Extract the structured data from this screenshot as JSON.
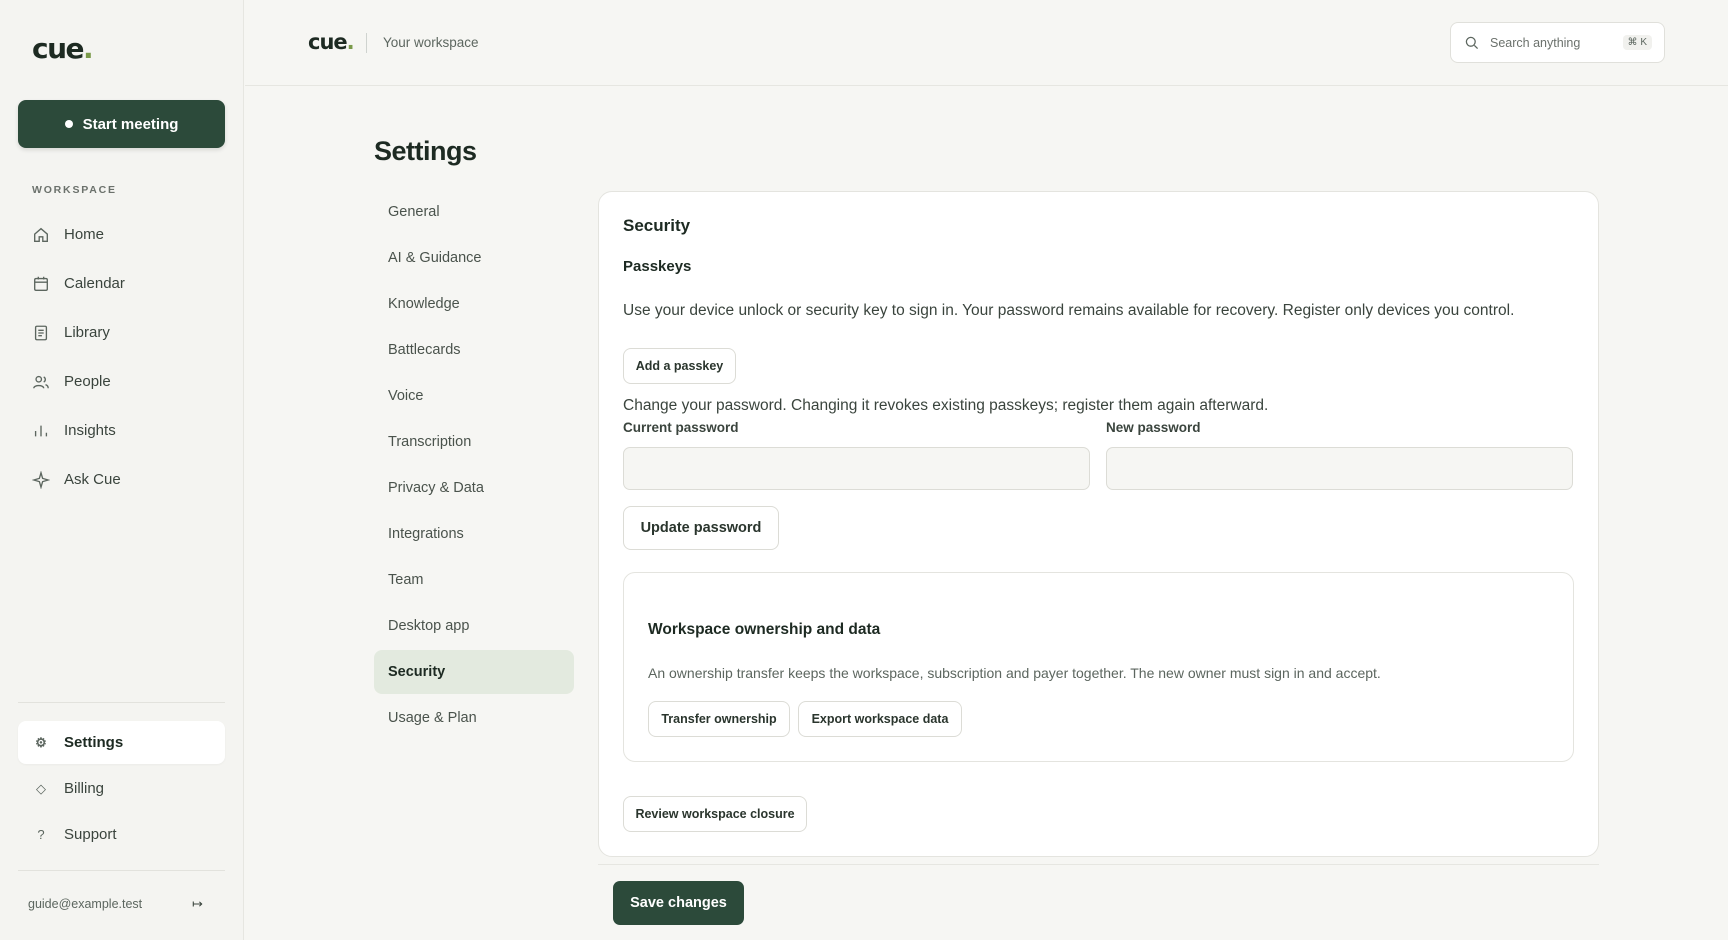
{
  "brand": {
    "logo_text": "cue",
    "logo_dot": "."
  },
  "sidebar": {
    "start_meeting": "Start meeting",
    "section_label": "WORKSPACE",
    "items": [
      {
        "label": "Home",
        "icon": "home-icon"
      },
      {
        "label": "Calendar",
        "icon": "calendar-icon"
      },
      {
        "label": "Library",
        "icon": "library-icon"
      },
      {
        "label": "People",
        "icon": "people-icon"
      },
      {
        "label": "Insights",
        "icon": "insights-icon"
      },
      {
        "label": "Ask Cue",
        "icon": "sparkle-icon"
      }
    ],
    "bottom_items": [
      {
        "label": "Settings",
        "icon": "gear-icon",
        "active": true
      },
      {
        "label": "Billing",
        "icon": "diamond-icon"
      },
      {
        "label": "Support",
        "icon": "help-icon"
      }
    ],
    "user_email": "guide@example.test"
  },
  "topbar": {
    "workspace": "Your workspace",
    "search_placeholder": "Search anything",
    "search_shortcut": "⌘ K"
  },
  "settings": {
    "title": "Settings",
    "nav": [
      "General",
      "AI & Guidance",
      "Knowledge",
      "Battlecards",
      "Voice",
      "Transcription",
      "Privacy & Data",
      "Integrations",
      "Team",
      "Desktop app",
      "Security",
      "Usage & Plan"
    ],
    "active_nav": "Security"
  },
  "security": {
    "title": "Security",
    "passkeys_title": "Passkeys",
    "passkeys_desc": "Use your device unlock or security key to sign in. Your password remains available for recovery. Register only devices you control.",
    "add_passkey": "Add a passkey",
    "password_desc": "Change your password. Changing it revokes existing passkeys; register them again afterward.",
    "current_password_label": "Current password",
    "new_password_label": "New password",
    "update_password": "Update password",
    "ownership": {
      "title": "Workspace ownership and data",
      "desc": "An ownership transfer keeps the workspace, subscription and payer together. The new owner must sign in and accept.",
      "transfer": "Transfer ownership",
      "export": "Export workspace data"
    },
    "review_closure": "Review workspace closure"
  },
  "footer": {
    "save": "Save changes"
  },
  "colors": {
    "primary": "#2c4a3a",
    "accent_dot": "#7a9a4a",
    "active_nav_bg": "#e3eadf"
  }
}
